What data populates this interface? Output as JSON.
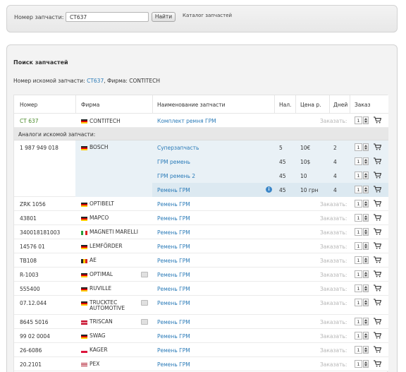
{
  "search": {
    "label": "Номер запчасти:",
    "value": "CT637",
    "button": "Найти",
    "catalog_link": "Каталог запчастей"
  },
  "panel": {
    "title": "Поиск запчастей",
    "query_prefix": "Номер искомой запчасти:",
    "query_number": "CT637",
    "query_firm": ", Фирма: CONTITECH"
  },
  "headers": {
    "number": "Номер",
    "firm": "Фирма",
    "name": "Наименование запчасти",
    "stock": "Нал.",
    "price": "Цена р.",
    "days": "Дней",
    "order": "Заказ"
  },
  "main_row": {
    "number": "CT 637",
    "firm": "CONTITECH",
    "name": "Комплект ремня ГРМ",
    "order_text": "Заказать:",
    "qty": "1"
  },
  "analogs_title": "Аналоги искомой запчасти:",
  "bosch": {
    "number": "1 987 949 018",
    "firm": "BOSCH",
    "offers": [
      {
        "name": "Суперзапчасть",
        "stock": "5",
        "price": "10€",
        "days": "2",
        "qty": "1"
      },
      {
        "name": "ГРМ ремень",
        "stock": "45",
        "price": "10$",
        "days": "4",
        "qty": "1"
      },
      {
        "name": "ГРМ ремень 2",
        "stock": "45",
        "price": "10",
        "days": "4",
        "qty": "1"
      },
      {
        "name": "Ремень ГРМ",
        "stock": "45",
        "price": "10 грн",
        "days": "4",
        "qty": "1"
      }
    ]
  },
  "rows": [
    {
      "number": "ZRK 1056",
      "firm": "OPTIBELT",
      "name": "Ремень ГРМ",
      "order_text": "Заказать:",
      "qty": "1"
    },
    {
      "number": "43801",
      "firm": "MAPCO",
      "name": "Ремень ГРМ",
      "order_text": "Заказать:",
      "qty": "1"
    },
    {
      "number": "340018181003",
      "firm": "MAGNETI MARELLI",
      "name": "Ремень ГРМ",
      "order_text": "Заказать:",
      "qty": "1"
    },
    {
      "number": "14576 01",
      "firm": "LEMFÖRDER",
      "name": "Ремень ГРМ",
      "order_text": "Заказать:",
      "qty": "1"
    },
    {
      "number": "TB108",
      "firm": "AE",
      "name": "Ремень ГРМ",
      "order_text": "Заказать:",
      "qty": "1"
    },
    {
      "number": "R-1003",
      "firm": "OPTIMAL",
      "name": "Ремень ГРМ",
      "order_text": "Заказать:",
      "qty": "1"
    },
    {
      "number": "555400",
      "firm": "RUVILLE",
      "name": "Ремень ГРМ",
      "order_text": "Заказать:",
      "qty": "1"
    },
    {
      "number": "07.12.044",
      "firm": "TRUCKTEC AUTOMOTIVE",
      "name": "Ремень ГРМ",
      "order_text": "Заказать:",
      "qty": "1"
    },
    {
      "number": "8645 5016",
      "firm": "TRISCAN",
      "name": "Ремень ГРМ",
      "order_text": "Заказать:",
      "qty": "1"
    },
    {
      "number": "99 02 0004",
      "firm": "SWAG",
      "name": "Ремень ГРМ",
      "order_text": "Заказать:",
      "qty": "1"
    },
    {
      "number": "26-6086",
      "firm": "KAGER",
      "name": "Ремень ГРМ",
      "order_text": "Заказать:",
      "qty": "1"
    },
    {
      "number": "20.2101",
      "firm": "PEX",
      "name": "Ремень ГРМ",
      "order_text": "Заказать:",
      "qty": "1"
    }
  ],
  "colors": {
    "link": "#2b7bb8",
    "number_green": "#4a8a2a",
    "order_placeholder": "#b5b5b5",
    "bosch_block": "#e9f1f6"
  }
}
